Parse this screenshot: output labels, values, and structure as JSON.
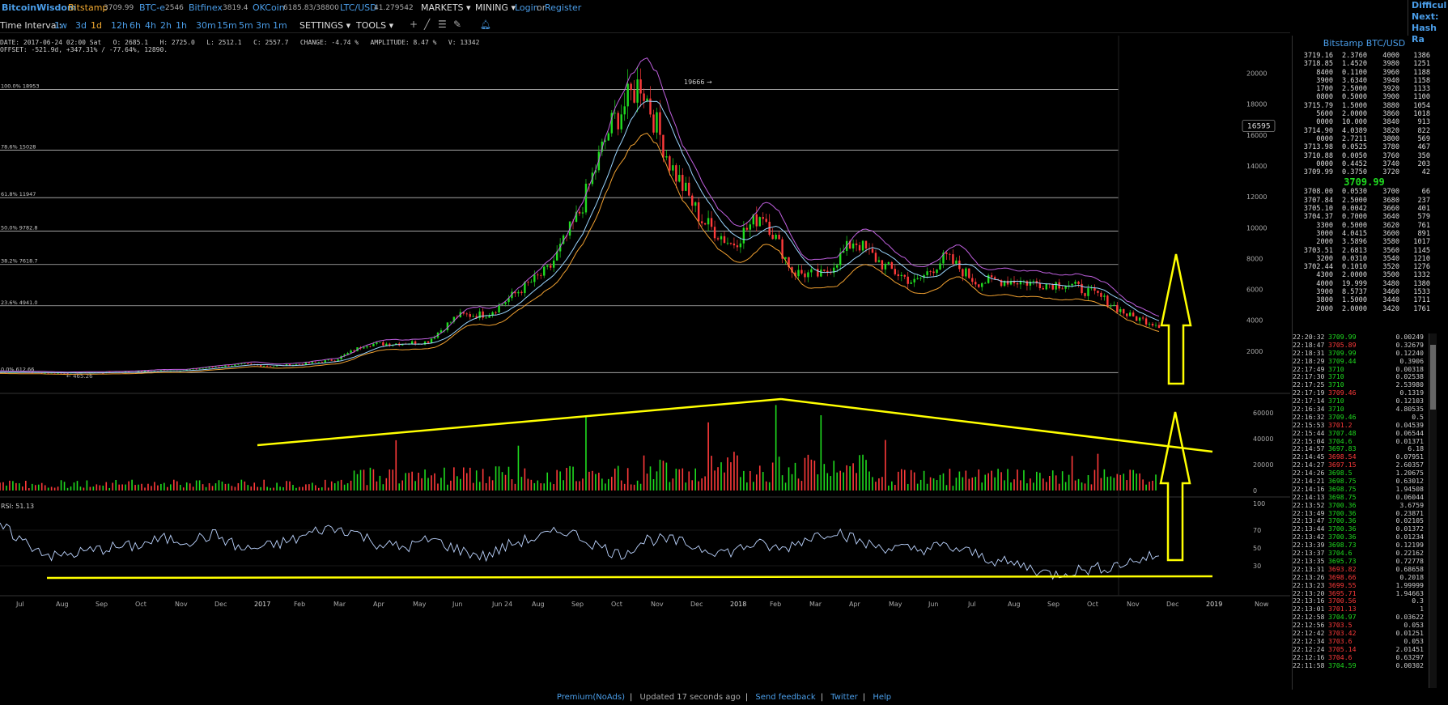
{
  "topbar": {
    "logo": "BitcoinWisdom",
    "tickers": [
      {
        "name": "Bitstamp",
        "price": "3709.99"
      },
      {
        "name": "BTC-e",
        "price": "2546"
      },
      {
        "name": "Bitfinex",
        "price": "3819.4"
      },
      {
        "name": "OKCoin",
        "price": "6185.83/38800"
      },
      {
        "name": "LTC/USD",
        "price": "41.279542"
      }
    ],
    "markets": "MARKETS",
    "mining": "MINING",
    "login": "Login",
    "or": "or",
    "register": "Register",
    "right_panel": [
      "Difficul",
      "Next:",
      "Hash Ra"
    ]
  },
  "toolbar": {
    "interval_label": "Time Interval:",
    "intervals": [
      "1w",
      "3d",
      "1d",
      "12h",
      "6h",
      "4h",
      "2h",
      "1h",
      "30m",
      "15m",
      "5m",
      "3m",
      "1m"
    ],
    "active_interval": "1d",
    "settings": "SETTINGS",
    "tools": "TOOLS",
    "tool_icons": [
      "plus-icon",
      "line-icon",
      "fib-icon",
      "pencil-icon",
      "bell-icon"
    ]
  },
  "info": {
    "line1": "DATE: 2017-06-24 02:00 Sat   O: 2685.1   H: 2725.0   L: 2512.1   C: 2557.7   CHANGE: -4.74 %   AMPLITUDE: 8.47 %   V: 13342",
    "line2": "OFFSET: -521.9d, +347.31% / -77.64%, 12890."
  },
  "colors": {
    "up": "#1fdc1f",
    "down": "#ff3a3a",
    "link": "#4a9de8",
    "annot": "#ffff00",
    "bb_outer": "#c060e0",
    "ema_fast": "#9ad6ff",
    "ema_slow": "#f0a030"
  },
  "fib_levels": [
    {
      "label": "100.0% 18953",
      "value": 18953
    },
    {
      "label": "78.6% 15028",
      "value": 15028
    },
    {
      "label": "61.8% 11947",
      "value": 11947
    },
    {
      "label": "50.0% 9782.8",
      "value": 9782.8
    },
    {
      "label": "38.2% 7618.7",
      "value": 7618.7
    },
    {
      "label": "23.6% 4941.0",
      "value": 4941.0
    },
    {
      "label": "0.0% 612.66",
      "value": 612.66
    }
  ],
  "chart_data": [
    {
      "type": "line",
      "title": "",
      "ylim": [
        0,
        21500
      ],
      "yticks": [
        2000,
        4000,
        6000,
        8000,
        10000,
        12000,
        14000,
        16000,
        18000,
        20000
      ],
      "cursor_price": "16595",
      "high_label": "19666",
      "low_label": "465.26",
      "xlabels": [
        "Jul",
        "Aug",
        "Sep",
        "Oct",
        "Nov",
        "Dec",
        "2017",
        "Feb",
        "Mar",
        "Apr",
        "May",
        "Jun",
        "Jun 24",
        "Aug",
        "Sep",
        "Oct",
        "Nov",
        "Dec",
        "2018",
        "Feb",
        "Mar",
        "Apr",
        "May",
        "Jun",
        "Jul",
        "Aug",
        "Sep",
        "Oct",
        "Nov",
        "Dec",
        "2019",
        "Now"
      ],
      "series": [
        {
          "values": [
            650,
            620,
            580,
            600,
            640,
            720,
            760,
            980,
            1150,
            1030,
            1200,
            1450,
            2450,
            2500,
            2600,
            4300,
            4400,
            5900,
            7300,
            11000,
            16500,
            19500,
            14000,
            10500,
            8900,
            11000,
            7100,
            6900,
            9200,
            7500,
            6400,
            8100,
            6500,
            6600,
            6400,
            6350,
            5600,
            4300,
            3709
          ]
        }
      ],
      "x_index_labels": "Jul 2016 to Dec 2018 (monthly points)"
    },
    {
      "type": "bar",
      "title": "",
      "ylim": [
        0,
        70000
      ],
      "yticks": [
        0,
        20000,
        40000,
        60000
      ]
    },
    {
      "type": "line",
      "title": "RSI: 51.13",
      "ylim": [
        0,
        100
      ],
      "yticks": [
        30,
        50,
        70,
        100
      ],
      "series": [
        {
          "values": [
            75,
            55,
            40,
            45,
            50,
            52,
            60,
            58,
            65,
            48,
            52,
            60,
            72,
            70,
            55,
            50,
            60,
            48,
            40,
            55,
            62,
            70,
            55,
            42,
            60,
            58,
            50,
            45,
            55,
            48,
            62,
            70,
            55,
            50,
            48,
            52,
            45,
            35,
            30,
            20,
            25,
            28,
            35,
            42
          ]
        }
      ]
    }
  ],
  "panel": {
    "title": "Bitstamp BTC/USD",
    "asks": [
      [
        "3719.16",
        "2.3760",
        "4000",
        "1386"
      ],
      [
        "3718.85",
        "1.4520",
        "3980",
        "1251"
      ],
      [
        "8400",
        "0.1100",
        "3960",
        "1188"
      ],
      [
        "3900",
        "3.6340",
        "3940",
        "1158"
      ],
      [
        "1700",
        "2.5000",
        "3920",
        "1133"
      ],
      [
        "0800",
        "0.5000",
        "3900",
        "1100"
      ],
      [
        "3715.79",
        "1.5000",
        "3880",
        "1054"
      ],
      [
        "5600",
        "2.0000",
        "3860",
        "1018"
      ],
      [
        "0000",
        "10.000",
        "3840",
        "913"
      ],
      [
        "3714.90",
        "4.0389",
        "3820",
        "822"
      ],
      [
        "0000",
        "2.7211",
        "3800",
        "569"
      ],
      [
        "3713.98",
        "0.0525",
        "3780",
        "467"
      ],
      [
        "3710.88",
        "0.0050",
        "3760",
        "350"
      ],
      [
        "0000",
        "0.4452",
        "3740",
        "203"
      ],
      [
        "3709.99",
        "0.3750",
        "3720",
        "42"
      ]
    ],
    "last_price": "3709.99",
    "bids": [
      [
        "3708.00",
        "0.0530",
        "3700",
        "66"
      ],
      [
        "3707.84",
        "2.5000",
        "3680",
        "237"
      ],
      [
        "3705.10",
        "0.0042",
        "3660",
        "401"
      ],
      [
        "3704.37",
        "0.7000",
        "3640",
        "579"
      ],
      [
        "3300",
        "0.5000",
        "3620",
        "761"
      ],
      [
        "3000",
        "4.0415",
        "3600",
        "891"
      ],
      [
        "2000",
        "3.5896",
        "3580",
        "1017"
      ],
      [
        "3703.51",
        "2.6813",
        "3560",
        "1145"
      ],
      [
        "3200",
        "0.0310",
        "3540",
        "1210"
      ],
      [
        "3702.44",
        "0.1010",
        "3520",
        "1276"
      ],
      [
        "4300",
        "2.0000",
        "3500",
        "1332"
      ],
      [
        "4000",
        "19.999",
        "3480",
        "1380"
      ],
      [
        "3900",
        "8.5737",
        "3460",
        "1533"
      ],
      [
        "3800",
        "1.5000",
        "3440",
        "1711"
      ],
      [
        "2000",
        "2.0000",
        "3420",
        "1761"
      ]
    ],
    "trades": [
      [
        "22:20:32",
        "3709.99",
        "g",
        "0.00249"
      ],
      [
        "22:18:47",
        "3705.89",
        "r",
        "0.32679"
      ],
      [
        "22:18:31",
        "3709.99",
        "g",
        "0.12240"
      ],
      [
        "22:18:29",
        "3709.44",
        "g",
        "0.3906"
      ],
      [
        "22:17:49",
        "3710",
        "g",
        "0.00318"
      ],
      [
        "22:17:30",
        "3710",
        "g",
        "0.02538"
      ],
      [
        "22:17:25",
        "3710",
        "g",
        "2.53980"
      ],
      [
        "22:17:19",
        "3709.46",
        "r",
        "0.1319"
      ],
      [
        "22:17:14",
        "3710",
        "g",
        "0.12103"
      ],
      [
        "22:16:34",
        "3710",
        "g",
        "4.80535"
      ],
      [
        "22:16:32",
        "3709.46",
        "g",
        "0.5"
      ],
      [
        "22:15:53",
        "3701.2",
        "r",
        "0.04539"
      ],
      [
        "22:15:44",
        "3707.48",
        "g",
        "0.06544"
      ],
      [
        "22:15:04",
        "3704.6",
        "g",
        "0.01371"
      ],
      [
        "22:14:57",
        "3697.83",
        "g",
        "6.18"
      ],
      [
        "22:14:45",
        "3698.54",
        "r",
        "0.07951"
      ],
      [
        "22:14:27",
        "3697.15",
        "r",
        "2.60357"
      ],
      [
        "22:14:26",
        "3698.5",
        "g",
        "1.20675"
      ],
      [
        "22:14:21",
        "3698.75",
        "g",
        "0.63012"
      ],
      [
        "22:14:16",
        "3698.75",
        "g",
        "1.94508"
      ],
      [
        "22:14:13",
        "3698.75",
        "g",
        "0.06044"
      ],
      [
        "22:13:52",
        "3700.36",
        "g",
        "3.6759"
      ],
      [
        "22:13:49",
        "3700.36",
        "g",
        "0.23871"
      ],
      [
        "22:13:47",
        "3700.36",
        "g",
        "0.02105"
      ],
      [
        "22:13:44",
        "3700.36",
        "g",
        "0.01372"
      ],
      [
        "22:13:42",
        "3700.36",
        "g",
        "0.01234"
      ],
      [
        "22:13:39",
        "3698.73",
        "g",
        "0.12199"
      ],
      [
        "22:13:37",
        "3704.6",
        "g",
        "0.22162"
      ],
      [
        "22:13:35",
        "3695.73",
        "g",
        "0.72778"
      ],
      [
        "22:13:31",
        "3693.82",
        "r",
        "0.68658"
      ],
      [
        "22:13:26",
        "3698.66",
        "r",
        "0.2018"
      ],
      [
        "22:13:23",
        "3699.55",
        "r",
        "1.99999"
      ],
      [
        "22:13:20",
        "3695.71",
        "r",
        "1.94663"
      ],
      [
        "22:13:16",
        "3700.56",
        "r",
        "0.3"
      ],
      [
        "22:13:01",
        "3701.13",
        "r",
        "1"
      ],
      [
        "22:12:58",
        "3704.97",
        "g",
        "0.03622"
      ],
      [
        "22:12:56",
        "3703.5",
        "r",
        "0.053"
      ],
      [
        "22:12:42",
        "3703.42",
        "r",
        "0.01251"
      ],
      [
        "22:12:34",
        "3703.6",
        "r",
        "0.053"
      ],
      [
        "22:12:24",
        "3705.14",
        "r",
        "2.01451"
      ],
      [
        "22:12:16",
        "3704.6",
        "r",
        "0.63297"
      ],
      [
        "22:11:58",
        "3704.59",
        "g",
        "0.00302"
      ]
    ]
  },
  "footer": {
    "premium": "Premium(NoAds)",
    "updated": "Updated 17 seconds ago",
    "feedback": "Send feedback",
    "twitter": "Twitter",
    "help": "Help"
  }
}
